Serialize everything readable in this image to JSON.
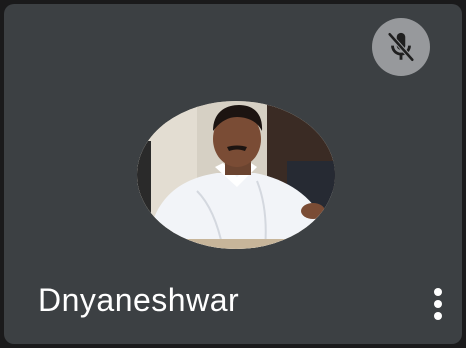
{
  "participant": {
    "name": "Dnyaneshwar",
    "microphone_status": "muted",
    "status_icon": "mic-off-icon",
    "menu_icon": "more-vert-icon"
  },
  "colors": {
    "tile_background": "#3c4043",
    "badge_background": "#97999c",
    "name_text": "#ffffff"
  }
}
